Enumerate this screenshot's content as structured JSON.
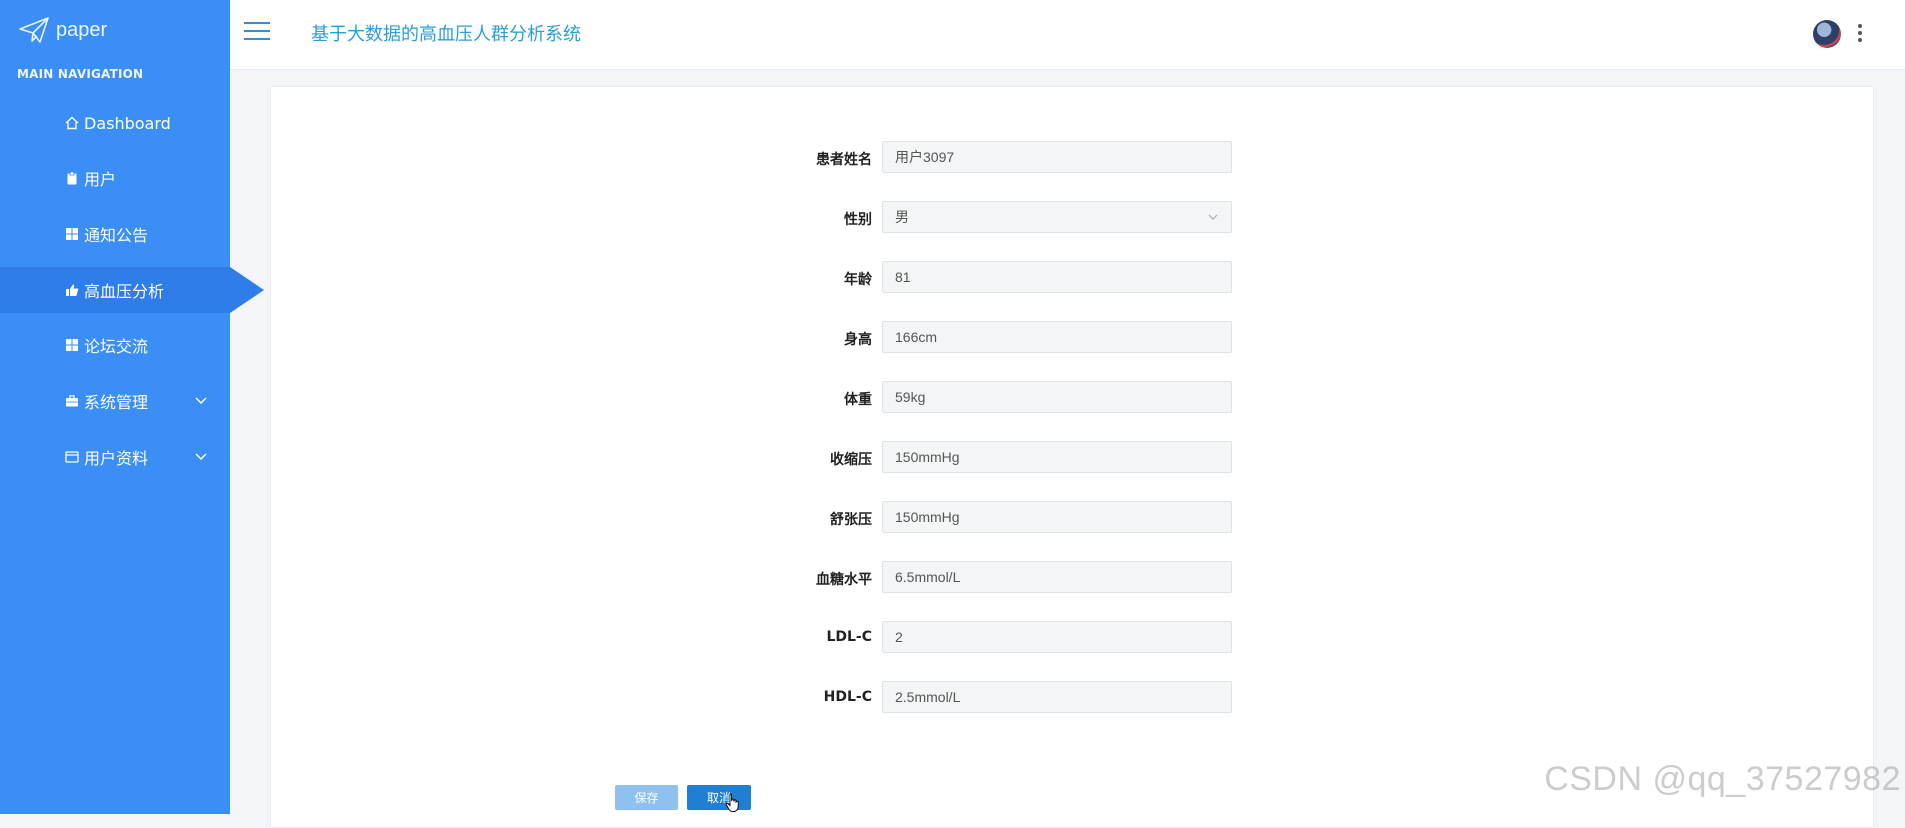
{
  "brand": {
    "name": "paper"
  },
  "sidebar": {
    "heading": "MAIN NAVIGATION",
    "items": [
      {
        "label": "Dashboard",
        "icon": "home-icon"
      },
      {
        "label": "用户",
        "icon": "clipboard-icon"
      },
      {
        "label": "通知公告",
        "icon": "grid-icon"
      },
      {
        "label": "高血压分析",
        "icon": "thumbs-up-icon",
        "active": true
      },
      {
        "label": "论坛交流",
        "icon": "grid-icon"
      },
      {
        "label": "系统管理",
        "icon": "briefcase-icon",
        "expandable": true
      },
      {
        "label": "用户资料",
        "icon": "id-card-icon",
        "expandable": true
      }
    ]
  },
  "header": {
    "title": "基于大数据的高血压人群分析系统"
  },
  "form": {
    "fields": [
      {
        "label": "患者姓名",
        "value": "用户3097"
      },
      {
        "label": "性别",
        "value": "男",
        "type": "select"
      },
      {
        "label": "年龄",
        "value": "81"
      },
      {
        "label": "身高",
        "value": "166cm"
      },
      {
        "label": "体重",
        "value": "59kg"
      },
      {
        "label": "收缩压",
        "value": "150mmHg"
      },
      {
        "label": "舒张压",
        "value": "150mmHg"
      },
      {
        "label": "血糖水平",
        "value": "6.5mmol/L"
      },
      {
        "label": "LDL-C",
        "value": "2"
      },
      {
        "label": "HDL-C",
        "value": "2.5mmol/L"
      }
    ],
    "save_label": "保存",
    "cancel_label": "取消"
  },
  "watermark": "CSDN @qq_37527982",
  "colors": {
    "sidebar": "#3a8ef6",
    "sidebar_active": "#2f7de8",
    "title": "#2a9fd6",
    "save_button": "#8fc1ee",
    "cancel_button": "#1f7fd2"
  }
}
